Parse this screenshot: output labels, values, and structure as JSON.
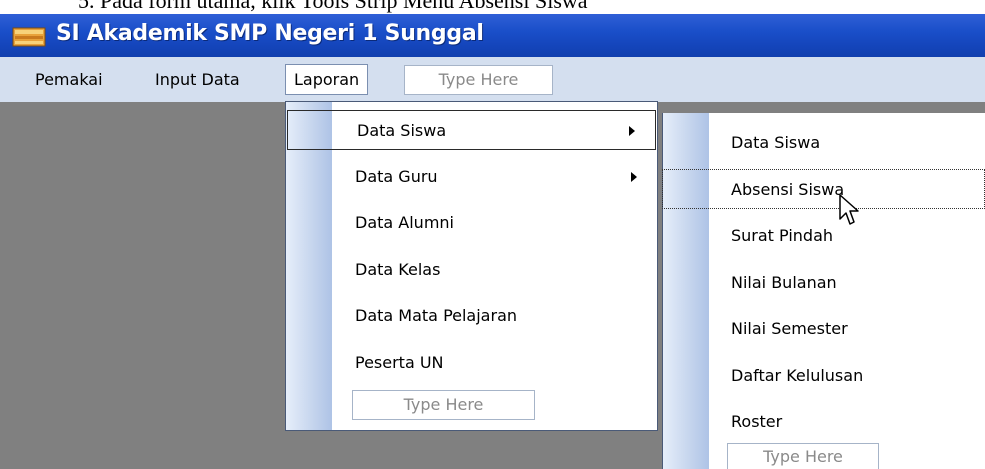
{
  "caption": "5.   Pada form utama, klik Tools Strip Menu Absensi Siswa",
  "window": {
    "title": "SI Akademik SMP Negeri 1 Sunggal"
  },
  "menubar": {
    "items": [
      "Pemakai",
      "Input Data",
      "Laporan"
    ],
    "placeholder": "Type Here"
  },
  "laporan_menu": {
    "items": [
      {
        "label": "Data Siswa",
        "has_submenu": true,
        "selected": true
      },
      {
        "label": "Data Guru",
        "has_submenu": true,
        "selected": false
      },
      {
        "label": "Data Alumni",
        "has_submenu": false,
        "selected": false
      },
      {
        "label": "Data Kelas",
        "has_submenu": false,
        "selected": false
      },
      {
        "label": "Data Mata Pelajaran",
        "has_submenu": false,
        "selected": false
      },
      {
        "label": "Peserta UN",
        "has_submenu": false,
        "selected": false
      }
    ],
    "placeholder": "Type Here"
  },
  "data_siswa_submenu": {
    "items": [
      "Data Siswa",
      "Absensi Siswa",
      "Surat Pindah",
      "Nilai Bulanan",
      "Nilai Semester",
      "Daftar Kelulusan",
      "Roster"
    ],
    "focused": "Absensi Siswa",
    "placeholder": "Type Here"
  },
  "colors": {
    "titlebar": "#1a4fc9",
    "menubar": "#d4dfef",
    "client": "#808080"
  }
}
